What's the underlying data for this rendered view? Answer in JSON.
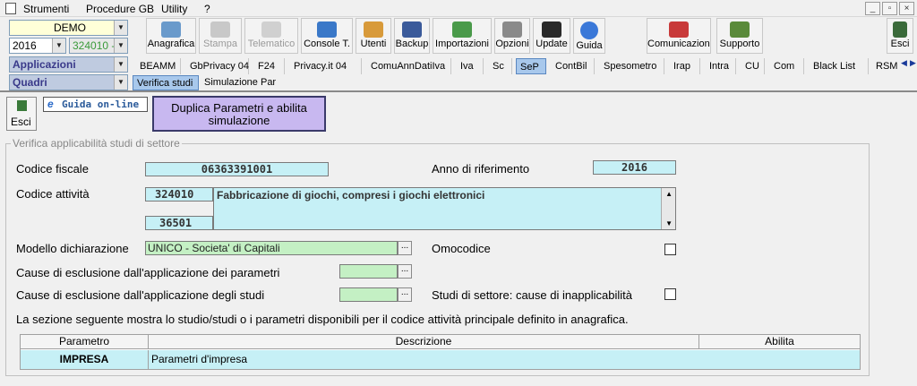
{
  "menu": {
    "items": [
      "Strumenti",
      "Procedure GB",
      "Utility",
      "?"
    ]
  },
  "window_controls": {
    "minimize": "_",
    "restore": "▫",
    "close": "×"
  },
  "left_panel": {
    "company": "DEMO",
    "year": "2016",
    "code": "324010 -",
    "applicazioni": "Applicazioni",
    "quadri": "Quadri"
  },
  "toolbar": {
    "buttons": [
      {
        "label": "Anagrafica",
        "icon": "anagrafica-icon",
        "enabled": true
      },
      {
        "label": "Stampa",
        "icon": "printer-icon",
        "enabled": false
      },
      {
        "label": "Telematico",
        "icon": "telematico-icon",
        "enabled": false
      },
      {
        "label": "Console T.",
        "icon": "console-icon",
        "enabled": true
      },
      {
        "label": "Utenti",
        "icon": "users-icon",
        "enabled": true
      },
      {
        "label": "Backup",
        "icon": "backup-icon",
        "enabled": true
      },
      {
        "label": "Importazioni",
        "icon": "import-icon",
        "enabled": true
      },
      {
        "label": "Opzioni",
        "icon": "wrench-icon",
        "enabled": true
      },
      {
        "label": "Update",
        "icon": "update-icon",
        "enabled": true
      },
      {
        "label": "Guida",
        "icon": "help-icon",
        "enabled": true
      },
      {
        "label": "Comunicazioni",
        "icon": "comunicazioni-icon",
        "enabled": true
      },
      {
        "label": "Supporto",
        "icon": "supporto-icon",
        "enabled": true
      },
      {
        "label": "Esci",
        "icon": "exit-icon",
        "enabled": true
      }
    ]
  },
  "tabs": [
    "BEAMM",
    "GbPrivacy 04",
    "F24",
    "Privacy.it 04",
    "ComuAnnDatiIva",
    "Iva",
    "Sc",
    "SeP",
    "ContBil",
    "Spesometro",
    "Irap",
    "Intra",
    "CU",
    "Com",
    "Black List",
    "RSM"
  ],
  "active_tab": "SeP",
  "subtabs": [
    "Verifica studi",
    "Simulazione Par"
  ],
  "actions": {
    "esci": "Esci",
    "guida": "Guida on-line",
    "duplica": "Duplica Parametri e abilita simulazione"
  },
  "form": {
    "section_title": "Verifica applicabilità studi di settore",
    "codice_fiscale_label": "Codice fiscale",
    "codice_fiscale": "06363391001",
    "anno_label": "Anno di riferimento",
    "anno": "2016",
    "codice_attivita_label": "Codice attività",
    "codice_attivita": "324010",
    "codice_attivita_desc": "Fabbricazione di giochi, compresi i giochi elettronici",
    "codice_secondario": "36501",
    "modello_label": "Modello dichiarazione",
    "modello": "UNICO - Societa' di Capitali",
    "omocodice_label": "Omocodice",
    "cause_param_label": "Cause di esclusione dall'applicazione dei parametri",
    "cause_studi_label": "Cause di esclusione dall'applicazione degli studi",
    "studi_inapp_label": "Studi di settore: cause di inapplicabilità",
    "info_text": "La sezione seguente mostra lo studio/studi o i parametri disponibili per il codice attività principale definito in anagrafica."
  },
  "table": {
    "headers": [
      "Parametro",
      "Descrizione",
      "Abilita"
    ],
    "rows": [
      {
        "parametro": "IMPRESA",
        "descrizione": "Parametri d'impresa"
      }
    ]
  },
  "colors": {
    "cyan_field": "#c6f0f6",
    "green_field": "#c4f0c4",
    "tab_active": "#a8c8ec",
    "duplica_btn": "#c8b8f0"
  }
}
